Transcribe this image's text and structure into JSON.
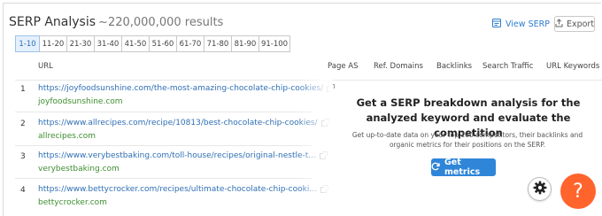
{
  "header": {
    "title": "SERP Analysis",
    "result_count": "~220,000,000 results",
    "view_serp_label": "View SERP",
    "export_label": "Export"
  },
  "pagination": {
    "pages": [
      "1-10",
      "11-20",
      "21-30",
      "31-40",
      "41-50",
      "51-60",
      "61-70",
      "71-80",
      "81-90",
      "91-100"
    ],
    "active": "1-10"
  },
  "table": {
    "columns": {
      "url": "URL",
      "page_as": "Page AS",
      "ref_domains": "Ref. Domains",
      "backlinks": "Backlinks",
      "search_traffic": "Search Traffic",
      "url_keywords": "URL Keywords"
    },
    "rows": [
      {
        "num": "1",
        "url": "https://joyfoodsunshine.com/the-most-amazing-chocolate-chip-cookies/",
        "domain": "joyfoodsunshine.com"
      },
      {
        "num": "2",
        "url": "https://www.allrecipes.com/recipe/10813/best-chocolate-chip-cookies/",
        "domain": "allrecipes.com"
      },
      {
        "num": "3",
        "url": "https://www.verybestbaking.com/toll-house/recipes/original-nestle-t…",
        "domain": "verybestbaking.com"
      },
      {
        "num": "4",
        "url": "https://www.bettycrocker.com/recipes/ultimate-chocolate-chip-cooki…",
        "domain": "bettycrocker.com"
      }
    ]
  },
  "promo": {
    "title": "Get a SERP breakdown analysis for the analyzed keyword and evaluate the competition",
    "subtitle": "Get up-to-date data on your top 100 competitors, their backlinks and organic metrics for their positions on the SERP.",
    "button_label": "Get metrics"
  },
  "widgets": {
    "help_label": "?"
  },
  "colors": {
    "link": "#2f6fb4",
    "domain": "#3e8e2f",
    "primary_button": "#2f86d8",
    "help_button": "#ff642d"
  },
  "icons": [
    "view-serp-icon",
    "export-icon",
    "external-link-icon",
    "refresh-icon",
    "gear-icon",
    "help-icon"
  ]
}
